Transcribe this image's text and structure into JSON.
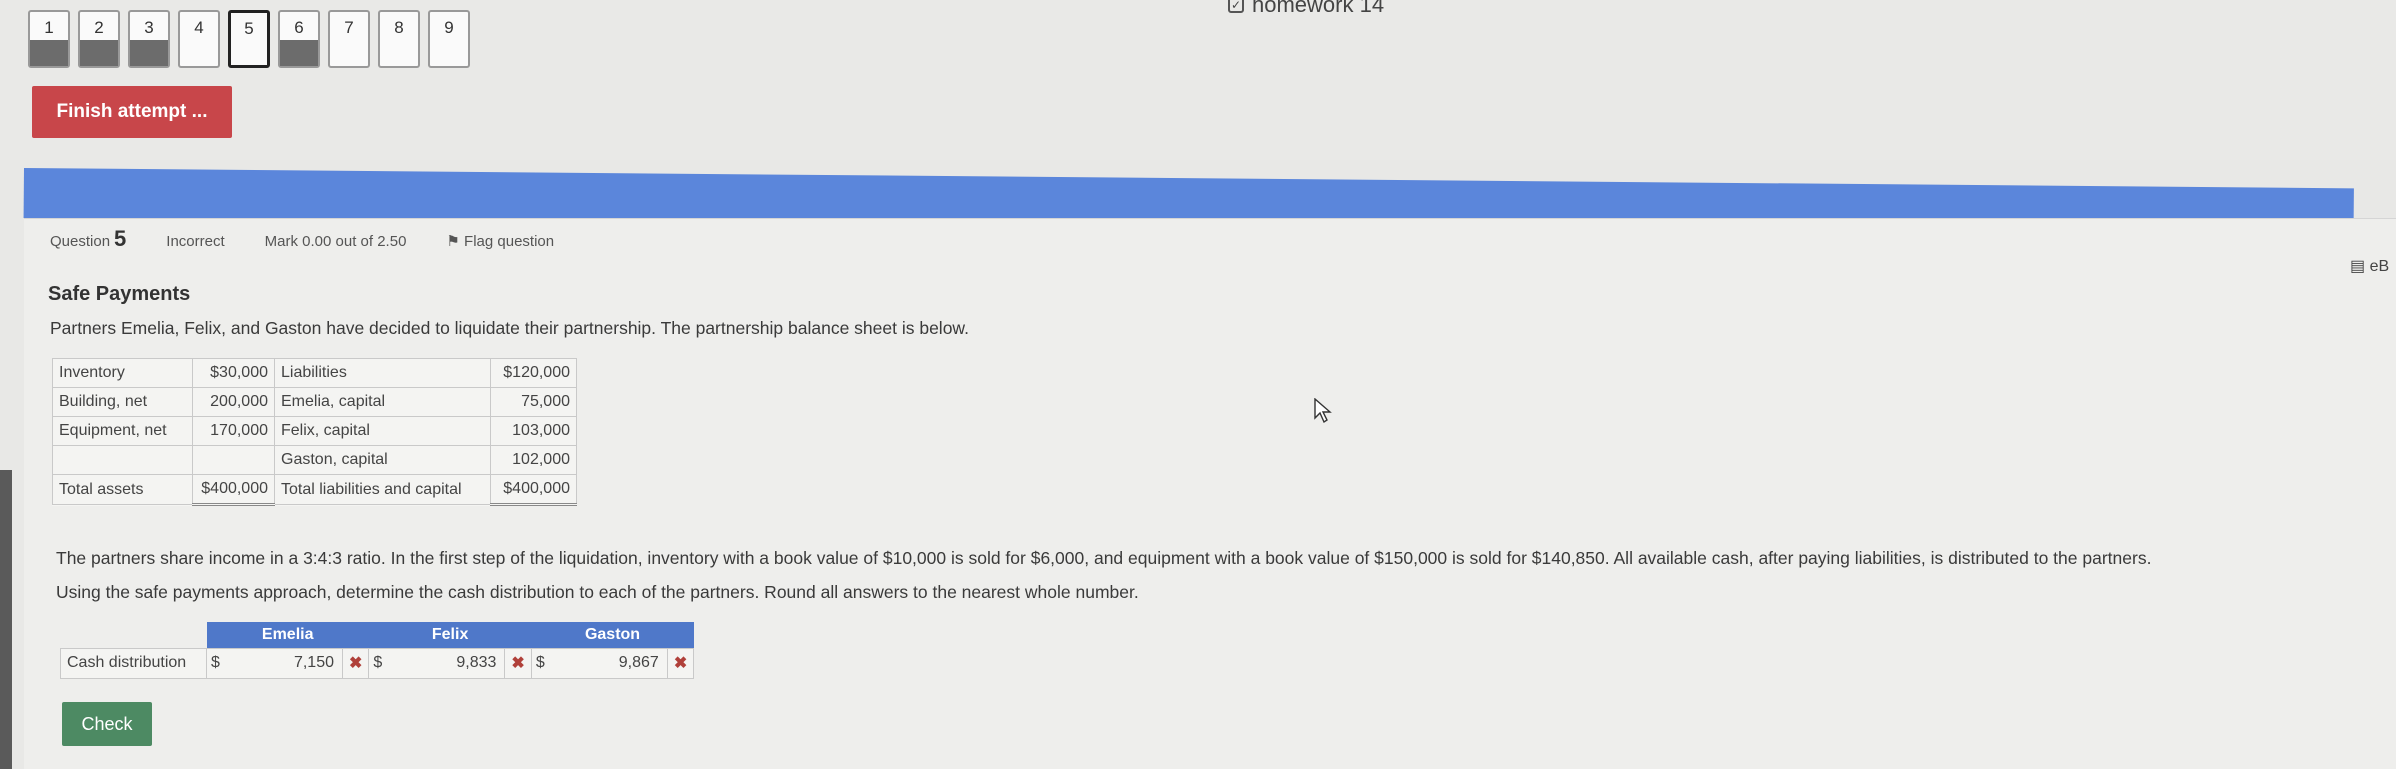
{
  "quiz": {
    "title": "homework 14"
  },
  "navigation": {
    "questions": [
      {
        "label": "1",
        "answered": true
      },
      {
        "label": "2",
        "answered": true
      },
      {
        "label": "3",
        "answered": true
      },
      {
        "label": "4",
        "answered": false
      },
      {
        "label": "5",
        "answered": false,
        "current": true
      },
      {
        "label": "6",
        "answered": true
      },
      {
        "label": "7",
        "answered": false
      },
      {
        "label": "8",
        "answered": false
      },
      {
        "label": "9",
        "answered": false
      }
    ],
    "finish_label": "Finish attempt ..."
  },
  "question_info": {
    "question_prefix": "Question",
    "number": "5",
    "status": "Incorrect",
    "mark": "Mark 0.00 out of 2.50",
    "flag_label": "Flag question"
  },
  "ebook_label": "eB",
  "question": {
    "heading": "Safe Payments",
    "intro": "Partners Emelia, Felix, and Gaston have decided to liquidate their partnership. The partnership balance sheet is below.",
    "balance_sheet": [
      [
        "Inventory",
        "$30,000",
        "Liabilities",
        "$120,000"
      ],
      [
        "Building, net",
        "200,000",
        "Emelia, capital",
        "75,000"
      ],
      [
        "Equipment, net",
        "170,000",
        "Felix, capital",
        "103,000"
      ],
      [
        "",
        "",
        "Gaston, capital",
        "102,000"
      ],
      [
        "Total assets",
        "$400,000",
        "Total liabilities and capital",
        "$400,000"
      ]
    ],
    "paragraph1": "The partners share income in a 3:4:3 ratio. In the first step of the liquidation, inventory with a book value of $10,000 is sold for $6,000, and equipment with a book value of $150,000 is sold for $140,850. All available cash, after paying liabilities, is distributed to the partners.",
    "paragraph2": "Using the safe payments approach, determine the cash distribution to each of the partners. Round all answers to the nearest whole number.",
    "cash_table": {
      "headers": [
        "Emelia",
        "Felix",
        "Gaston"
      ],
      "row_label": "Cash distribution",
      "currency": "$",
      "values": [
        "7,150",
        "9,833",
        "9,867"
      ],
      "incorrect_mark": "✖"
    },
    "check_label": "Check"
  }
}
